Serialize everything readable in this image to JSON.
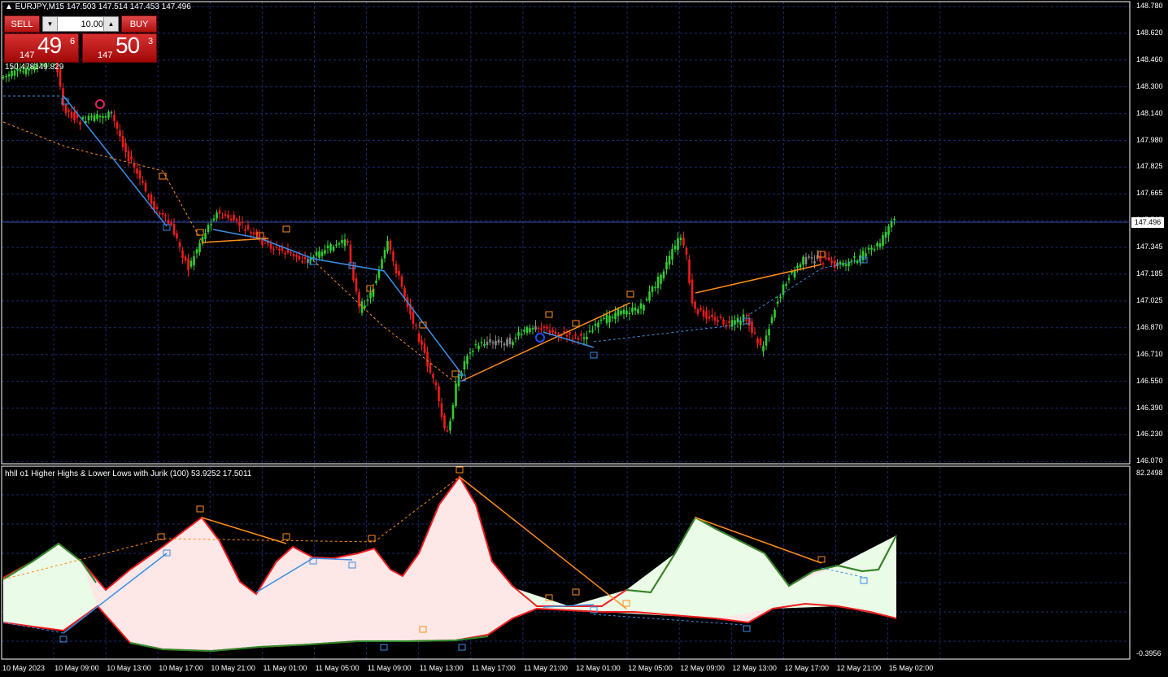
{
  "chart": {
    "symbol_info": "▲ EURJPY,M15  147.503 147.514 147.453 147.496",
    "indicator_title": "hhll o1 Higher Highs & Lower Lows with Jurik (100) 53.9252 17.5011",
    "object_label": "150.478149.829",
    "current_price": "147.496",
    "price_axis": [
      "148.780",
      "148.620",
      "148.460",
      "148.300",
      "148.140",
      "147.980",
      "147.825",
      "147.665",
      "147.505",
      "147.345",
      "147.185",
      "147.025",
      "146.870",
      "146.710",
      "146.550",
      "146.390",
      "146.230",
      "146.070"
    ],
    "indicator_axis": {
      "top": "82.2498",
      "bottom": "-0.3956"
    },
    "time_axis": [
      "10 May 2023",
      "10 May 09:00",
      "10 May 13:00",
      "10 May 17:00",
      "10 May 21:00",
      "11 May 01:00",
      "11 May 05:00",
      "11 May 09:00",
      "11 May 13:00",
      "11 May 17:00",
      "11 May 21:00",
      "12 May 01:00",
      "12 May 05:00",
      "12 May 09:00",
      "12 May 13:00",
      "12 May 17:00",
      "12 May 21:00",
      "15 May 02:00"
    ],
    "colors": {
      "background": "#000000",
      "grid": "#1a2a6e",
      "bull": "#33cc33",
      "bear": "#ee1c1c",
      "neutral": "#888888",
      "blue_line": "#3a8ee6",
      "orange_line": "#ff8c1a",
      "bear_fill": "#fde7e7",
      "bull_fill": "#eafbe7"
    }
  },
  "trade_panel": {
    "sell_label": "SELL",
    "buy_label": "BUY",
    "lot": "10.00",
    "sell_price": {
      "big": "147",
      "main": "49",
      "sup": "6"
    },
    "buy_price": {
      "big": "147",
      "main": "50",
      "sup": "3"
    }
  }
}
